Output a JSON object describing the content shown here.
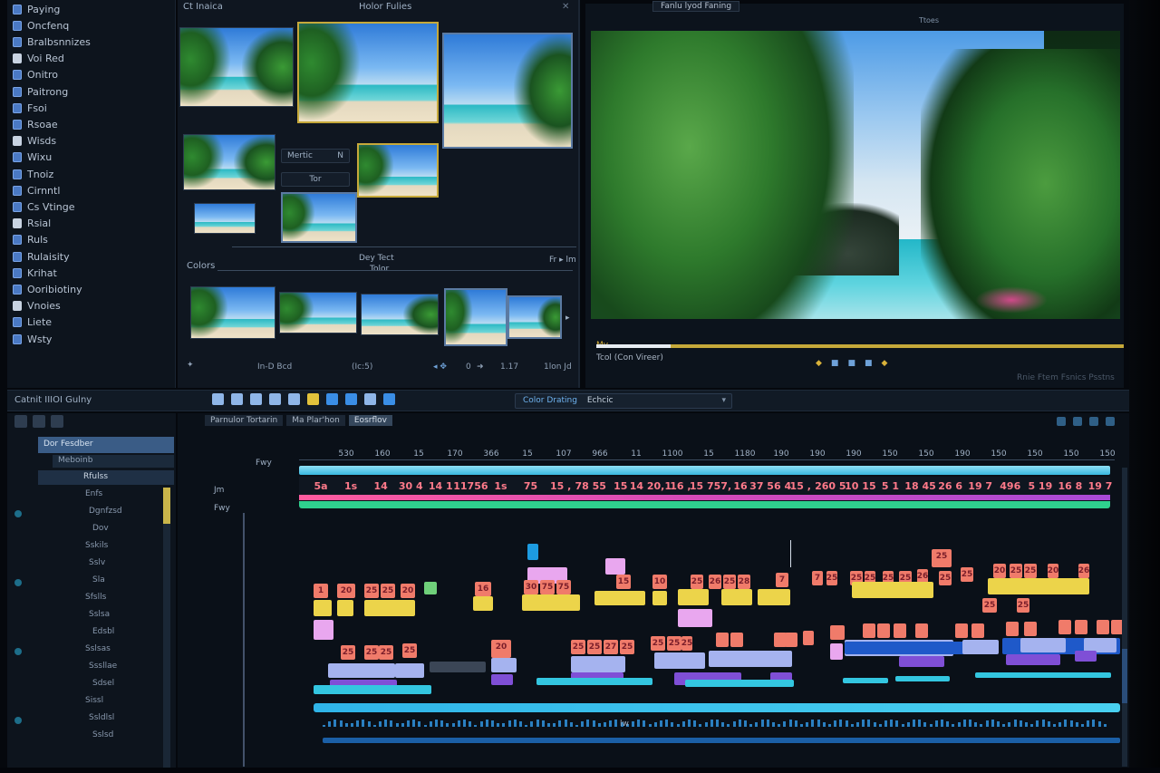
{
  "left_panel": {
    "items": [
      "Paying",
      "Oncfenq",
      "Bralbsnnizes",
      "Voi Red",
      "Onitro",
      "Paitrong",
      "Fsoi",
      "Rsoae",
      "Wisds",
      "Wixu",
      "Tnoiz",
      "Cirnntl",
      "Cs Vtinge",
      "Rsial",
      "Ruls",
      "Rulaisity",
      "Krihat",
      "Ooribiotiny",
      "Vnoies",
      "Liete",
      "Wsty"
    ]
  },
  "media_bin": {
    "title_left": "Ct Inaica",
    "title_center": "Holor Fulies",
    "box_mode": "Mertic",
    "box_mode_suffix": "N",
    "box_sub": "Tor",
    "section_top": "Dey Tect",
    "section_bottom": "Tolor",
    "section_right": "Fr ▸ lm",
    "colors_label": "Colors",
    "toolbar": {
      "t1": "In-D Bcd",
      "t2": "(Ic:5)",
      "t3": "0",
      "t4": "1.17",
      "t5": "1lon Jd"
    }
  },
  "program": {
    "top_label": "Fanlu lyod Faning",
    "zoom_label": "Ttoes",
    "timecode_label": "Mv",
    "clip_label": "Tcol (Con Vireer)",
    "faded_right": "Rnie Ftem Fsnics Psstns"
  },
  "toolbar": {
    "app_name": "Catnit IIIOI Gulny",
    "workspace_active": "Color Drating",
    "workspace_other": "Echcic"
  },
  "project": {
    "search": "Dor Fesdber",
    "sub": "Meboinb",
    "selected": "Rfulss",
    "items": [
      "Enfs",
      "Dgnfzsd",
      "Dov",
      "Sskils",
      "Sslv",
      "Sla",
      "Sfslls",
      "Sslsa",
      "Edsbl",
      "Sslsas",
      "Sssllae",
      "Sdsel",
      "Sissl",
      "Ssldlsl",
      "Sslsd"
    ]
  },
  "timeline": {
    "tabs": [
      "Parnulor Tortarin",
      "Ma Plar'hon",
      "Eosrflov"
    ],
    "active_tab_index": 2,
    "track_labels": {
      "top": "Fwy",
      "v1": "Jm",
      "v2": "Fwy"
    },
    "ruler_ticks": [
      "530",
      "160",
      "15",
      "170",
      "366",
      "15",
      "107",
      "966",
      "11",
      "1100",
      "15",
      "1180",
      "190",
      "190",
      "190",
      "150",
      "150",
      "190",
      "150",
      "150",
      "150",
      "150"
    ],
    "track_numbers": [
      "5a",
      "1s",
      "14",
      "30 4",
      "14 1",
      "11756",
      "1s",
      "75",
      "15 ,",
      "78 55",
      "15",
      "14 20,1",
      "16 ,",
      "15 757,",
      "16",
      "37 56 4",
      "15 ,",
      "260 5",
      "10 15",
      "5 1",
      "18 45",
      "26 6",
      "19 7",
      "496",
      "5 19",
      "16 8",
      "19 7"
    ],
    "clip_numbers": [
      "1",
      "20",
      "25",
      "25",
      "20",
      "16",
      "30",
      "75",
      "75",
      "15",
      "10",
      "25",
      "26",
      "25",
      "28",
      "7",
      "7",
      "25",
      "25",
      "25",
      "25",
      "25",
      "26",
      "25",
      "25",
      "25",
      "20",
      "25",
      "25",
      "20",
      "26",
      "25",
      "25",
      "25",
      "25",
      "25",
      "25",
      "20",
      "25",
      "25",
      "27",
      "25",
      "25",
      "25",
      "25"
    ],
    "mid_label": "lw"
  },
  "colors": {
    "accent": "#c6a93a",
    "clip_coral": "#f07b6a",
    "clip_yellow": "#ecd44a",
    "clip_lavender": "#e9a7ef",
    "clip_violet": "#7f4fd6",
    "clip_blue": "#1f59c9",
    "clip_teal": "#33c6e0",
    "track_pink": "#ff5b9e",
    "track_green": "#2fd08e",
    "track_cyan": "#39b8e0"
  }
}
